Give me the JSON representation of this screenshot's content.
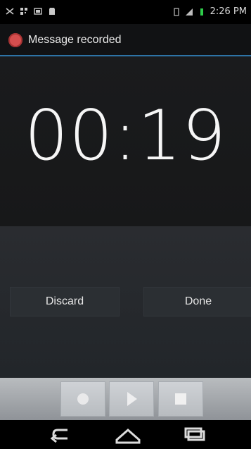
{
  "status_bar": {
    "time": "2:26 PM",
    "left_icons": [
      "missed-call-icon",
      "qr-icon",
      "screenshot-icon",
      "sd-card-icon"
    ],
    "right_icons": [
      "battery-icon",
      "signal-icon",
      "battery-level-icon"
    ]
  },
  "header": {
    "title": "Message recorded",
    "icon": "microphone-icon",
    "accent": "#2d73a6"
  },
  "timer": {
    "value": "00:19"
  },
  "actions": {
    "discard": "Discard",
    "done": "Done"
  },
  "media_controls": {
    "record_icon": "record-icon",
    "play_icon": "play-icon",
    "stop_icon": "stop-icon"
  },
  "navbar": {
    "back_icon": "back-icon",
    "home_icon": "home-icon",
    "recent_icon": "recent-apps-icon"
  }
}
